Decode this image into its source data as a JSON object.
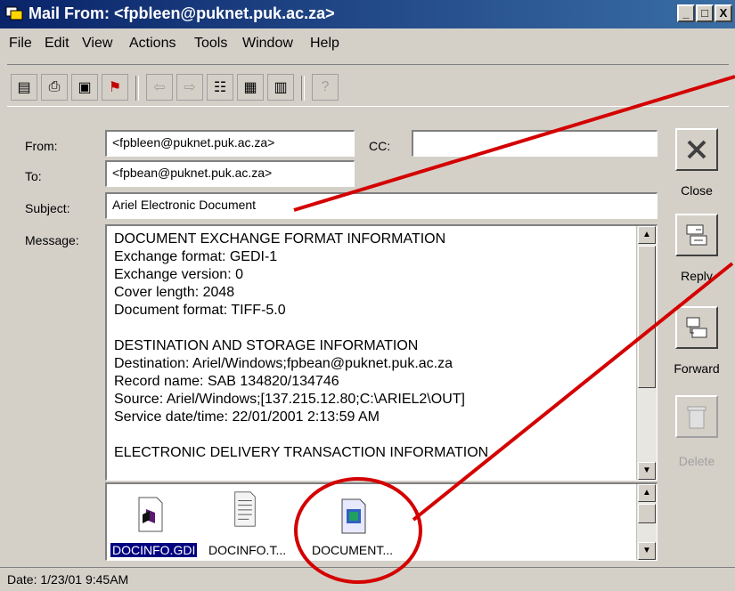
{
  "window": {
    "title": "Mail From: <fpbleen@puknet.puk.ac.za>",
    "buttons": [
      "_",
      "□",
      "X"
    ]
  },
  "menu": [
    "File",
    "Edit",
    "View",
    "Actions",
    "Tools",
    "Window",
    "Help"
  ],
  "form": {
    "from_label": "From:",
    "from_value": "<fpbleen@puknet.puk.ac.za>",
    "cc_label": "CC:",
    "cc_value": "",
    "to_label": "To:",
    "to_value": "<fpbean@puknet.puk.ac.za>",
    "subject_label": "Subject:",
    "subject_value": "Ariel Electronic Document",
    "message_label": "Message:"
  },
  "message_lines": [
    "DOCUMENT EXCHANGE FORMAT INFORMATION",
    "Exchange format:  GEDI-1",
    "Exchange version:  0",
    "Cover length:  2048",
    "Document format:  TIFF-5.0",
    "",
    "DESTINATION AND STORAGE INFORMATION",
    "Destination:  Ariel/Windows;fpbean@puknet.puk.ac.za",
    "Record name:  SAB 134820/134746",
    "Source:  Ariel/Windows;[137.215.12.80;C:\\ARIEL2\\OUT]",
    "Service date/time:  22/01/2001 2:13:59 AM",
    "",
    "ELECTRONIC DELIVERY TRANSACTION INFORMATION"
  ],
  "attachments": [
    {
      "name": "DOCINFO.GDI",
      "selected": true
    },
    {
      "name": "DOCINFO.T...",
      "selected": false
    },
    {
      "name": "DOCUMENT...",
      "selected": false
    }
  ],
  "side_buttons": {
    "close": "Close",
    "reply": "Reply",
    "forward": "Forward",
    "delete": "Delete"
  },
  "status": "Date: 1/23/01  9:45AM",
  "colors": {
    "annotation": "#d40000",
    "titlebar": "#0a246a",
    "selection": "#000080"
  }
}
